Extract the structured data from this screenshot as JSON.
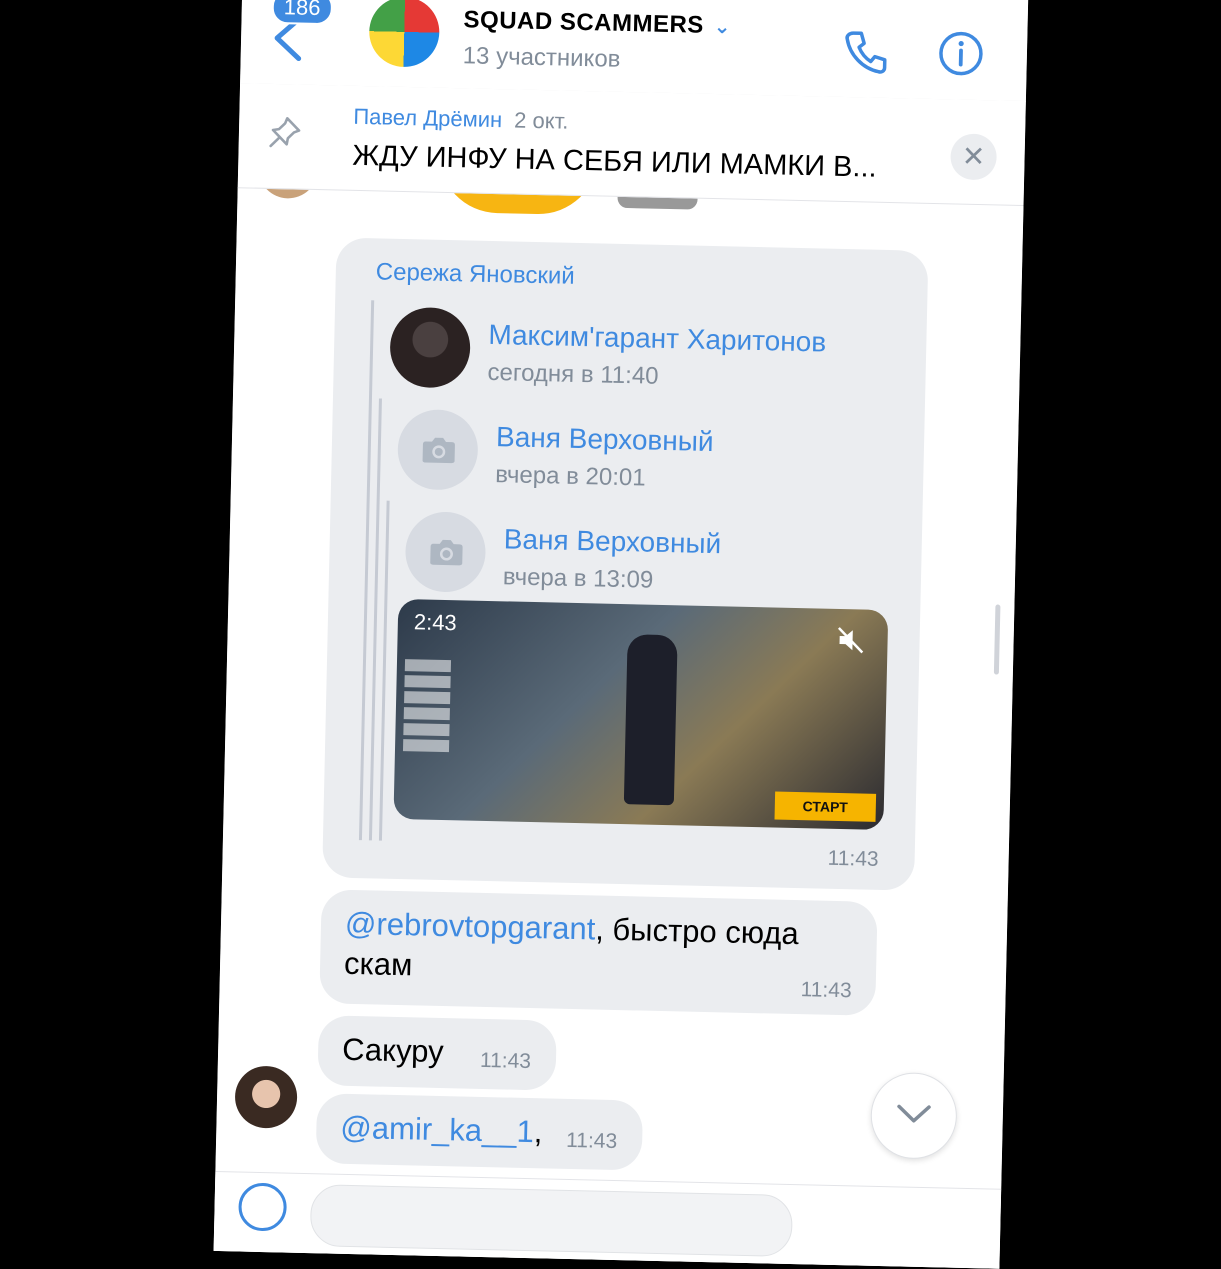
{
  "header": {
    "unread_badge": "186",
    "chat_title": "SQUAD SCAMMERS",
    "title_chevron": "⌄",
    "members": "13 участников",
    "call_icon": "phone-icon",
    "info_icon": "info-icon"
  },
  "pinned": {
    "author": "Павел Дрёмин",
    "date": "2 окт.",
    "text": "ЖДУ ИНФУ НА СЕБЯ ИЛИ МАМКИ В...",
    "close": "✕"
  },
  "forwarded": {
    "sender": "Сережа Яновский",
    "chain": [
      {
        "name": "Максим'гарант Харитонов",
        "time": "сегодня в 11:40"
      },
      {
        "name": "Ваня Верховный",
        "time": "вчера в 20:01"
      },
      {
        "name": "Ваня Верховный",
        "time": "вчера в 13:09"
      }
    ],
    "video_duration": "2:43",
    "video_button": "СТАРТ",
    "time": "11:43"
  },
  "messages": [
    {
      "mention": "@rebrovtopgarant",
      "text1": ", быстро сюда",
      "text2": "скам",
      "time": "11:43"
    },
    {
      "text": "Сакуру",
      "time": "11:43"
    },
    {
      "mention": "@amir_ka__1",
      "text": ",",
      "time": "11:43"
    }
  ],
  "colors": {
    "accent": "#3f8ae0",
    "bubble": "#ebedf0",
    "secondary_text": "#818c99"
  }
}
